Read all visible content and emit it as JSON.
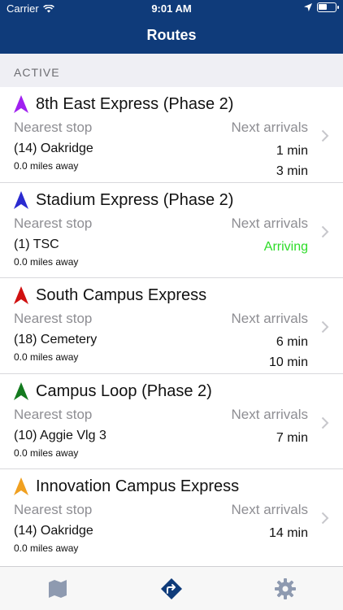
{
  "status_bar": {
    "carrier": "Carrier",
    "time": "9:01 AM",
    "battery_level": 0.55
  },
  "nav": {
    "title": "Routes"
  },
  "section": {
    "label": "ACTIVE"
  },
  "labels": {
    "nearest_stop": "Nearest stop",
    "next_arrivals": "Next arrivals"
  },
  "routes": [
    {
      "name": "8th East Express (Phase 2)",
      "color": "#a020f0",
      "stop": "(14) Oakridge",
      "distance": "0.0 miles away",
      "arrivals": [
        "1 min",
        "3 min"
      ]
    },
    {
      "name": "Stadium Express (Phase 2)",
      "color": "#2a2ad0",
      "stop": "(1) TSC",
      "distance": "0.0 miles away",
      "arrivals": [
        "Arriving"
      ]
    },
    {
      "name": "South Campus Express",
      "color": "#d01010",
      "stop": "(18) Cemetery",
      "distance": "0.0 miles away",
      "arrivals": [
        "6 min",
        "10 min"
      ]
    },
    {
      "name": "Campus Loop (Phase 2)",
      "color": "#137a1e",
      "stop": "(10) Aggie Vlg 3",
      "distance": "0.0 miles away",
      "arrivals": [
        "7 min"
      ]
    },
    {
      "name": "Innovation Campus Express",
      "color": "#f0a020",
      "stop": "(14) Oakridge",
      "distance": "0.0 miles away",
      "arrivals": [
        "14 min"
      ]
    }
  ],
  "colors": {
    "header": "#0f3b7a",
    "tab_inactive": "#8e9ab0",
    "tab_active": "#0f3b7a",
    "arriving": "#2ddc28"
  },
  "tabs": [
    {
      "icon": "map-icon",
      "active": false
    },
    {
      "icon": "directions-icon",
      "active": true
    },
    {
      "icon": "gear-icon",
      "active": false
    }
  ]
}
